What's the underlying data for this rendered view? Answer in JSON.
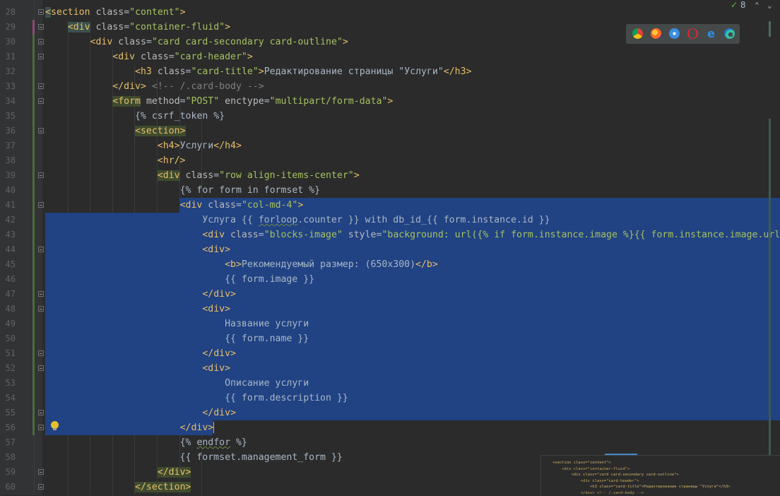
{
  "editor": {
    "lines": [
      {
        "n": "28",
        "html": "<span class=\"tag hl-tag\">&lt;</span><span class=\"tag\">section</span> <span class=\"attr\">class</span>=<span class=\"str\">\"content\"</span><span class=\"tag\">&gt;</span>"
      },
      {
        "n": "29",
        "html": "    <span class=\"tag hl-tag\">&lt;div</span> <span class=\"attr\">class</span>=<span class=\"str\">\"container-fluid\"</span><span class=\"tag\">&gt;</span>"
      },
      {
        "n": "30",
        "html": "        <span class=\"tag\">&lt;div</span> <span class=\"attr\">class</span>=<span class=\"str\">\"card card-secondary card-outline\"</span><span class=\"tag\">&gt;</span>"
      },
      {
        "n": "31",
        "html": "            <span class=\"tag\">&lt;div</span> <span class=\"attr\">class</span>=<span class=\"str\">\"card-header\"</span><span class=\"tag\">&gt;</span>"
      },
      {
        "n": "32",
        "html": "                <span class=\"tag\">&lt;h3</span> <span class=\"attr\">class</span>=<span class=\"str\">\"card-title\"</span><span class=\"tag\">&gt;</span>Редактирование страницы \"Услуги\"<span class=\"tag\">&lt;/h3&gt;</span>"
      },
      {
        "n": "33",
        "html": "            <span class=\"tag\">&lt;/div&gt;</span> <span class=\"comment\">&lt;!-- /.card-body --&gt;</span>"
      },
      {
        "n": "34",
        "html": "            <span class=\"tag hl-match\">&lt;form</span> <span class=\"attr\">method</span>=<span class=\"str\">\"POST\"</span> <span class=\"attr\">enctype</span>=<span class=\"str\">\"multipart/form-data\"</span><span class=\"tag\">&gt;</span>"
      },
      {
        "n": "35",
        "html": "                <span class=\"tpl\">{% csrf_token %}</span>"
      },
      {
        "n": "36",
        "html": "                <span class=\"tag hl-match\">&lt;section&gt;</span>"
      },
      {
        "n": "37",
        "html": "                    <span class=\"tag\">&lt;h4&gt;</span>Услуги<span class=\"tag\">&lt;/h4&gt;</span>"
      },
      {
        "n": "38",
        "html": "                    <span class=\"tag\">&lt;hr/&gt;</span>"
      },
      {
        "n": "39",
        "html": "                    <span class=\"tag hl-match\">&lt;div</span> <span class=\"attr\">class</span>=<span class=\"str\">\"row align-items-center\"</span><span class=\"tag\">&gt;</span>"
      },
      {
        "n": "40",
        "html": "                        <span class=\"tpl\">{% for form in formset %}</span>"
      },
      {
        "n": "41",
        "html": "                        <span class=\"tag\">&lt;div</span> <span class=\"attr\">class</span>=<span class=\"str\">\"col-md-4\"</span><span class=\"tag\">&gt;</span>"
      },
      {
        "n": "42",
        "html": "                            Услуга {{ <span class=\"squiggle\">forloop</span>.counter }} with db_id_{{ form.instance.id }}"
      },
      {
        "n": "43",
        "html": "                            <span class=\"tag\">&lt;div</span> <span class=\"attr\">class</span>=<span class=\"str\">\"blocks-image\"</span> <span class=\"attr\">style</span>=<span class=\"str\">\"background: url({% if form.instance.image %}{{ form.instance.image.url</span>"
      },
      {
        "n": "44",
        "html": "                            <span class=\"tag\">&lt;div&gt;</span>"
      },
      {
        "n": "45",
        "html": "                                <span class=\"tag\">&lt;b&gt;</span>Рекомендуемый размер: (650x300)<span class=\"tag\">&lt;/b&gt;</span>"
      },
      {
        "n": "46",
        "html": "                                {{ form.image }}"
      },
      {
        "n": "47",
        "html": "                            <span class=\"tag\">&lt;/div&gt;</span>"
      },
      {
        "n": "48",
        "html": "                            <span class=\"tag\">&lt;div&gt;</span>"
      },
      {
        "n": "49",
        "html": "                                Название услуги"
      },
      {
        "n": "50",
        "html": "                                {{ form.name }}"
      },
      {
        "n": "51",
        "html": "                            <span class=\"tag\">&lt;/div&gt;</span>"
      },
      {
        "n": "52",
        "html": "                            <span class=\"tag\">&lt;div&gt;</span>"
      },
      {
        "n": "53",
        "html": "                                Описание услуги"
      },
      {
        "n": "54",
        "html": "                                {{ form.description }}"
      },
      {
        "n": "55",
        "html": "                            <span class=\"tag\">&lt;/div&gt;</span>"
      },
      {
        "n": "56",
        "html": "                        <span class=\"tag\">&lt;/div&gt;</span><span class=\"caret\"></span>"
      },
      {
        "n": "57",
        "html": "                        <span class=\"tpl\">{% <span class=\"squiggle\">endfor</span> %}</span>"
      },
      {
        "n": "58",
        "html": "                        {{ formset.management_form }}"
      },
      {
        "n": "59",
        "html": "                    <span class=\"tag hl-match\">&lt;/div&gt;</span>"
      },
      {
        "n": "60",
        "html": "                <span class=\"tag hl-match\">&lt;/section&gt;</span>"
      }
    ]
  },
  "inspections": {
    "count": "8"
  },
  "browsers": [
    "chrome-icon",
    "firefox-icon",
    "safari-icon",
    "opera-icon",
    "ie-icon",
    "edge-icon"
  ],
  "minimap": {
    "lines": [
      "<section class=\"content\">",
      "    <div class=\"container-fluid\">",
      "        <div class=\"card card-secondary card-outline\">",
      "            <div class=\"card-header\">",
      "                <h3 class=\"card-title\">Редактирование страницы \"Услуги\"</h3>",
      "            </div> <!-- /.card-body -->"
    ]
  },
  "colors": {
    "background": "#2b2b2b",
    "selection": "#214283",
    "tag": "#e8bf6a",
    "string": "#a5c261"
  }
}
